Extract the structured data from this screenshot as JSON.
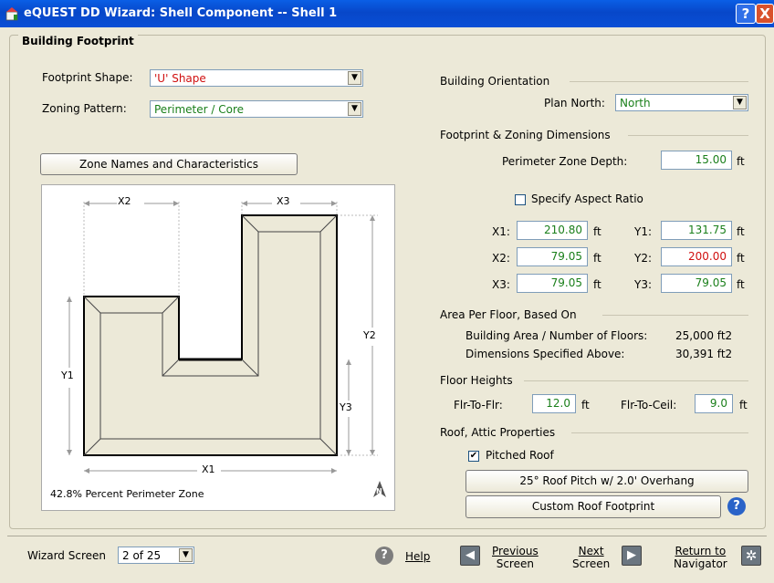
{
  "window": {
    "title": "eQUEST DD Wizard:  Shell Component  --  Shell 1",
    "help_glyph": "?",
    "close_glyph": "X"
  },
  "footprint": {
    "group_title": "Building Footprint",
    "shape_label": "Footprint Shape:",
    "shape_value": "'U' Shape",
    "zoning_label": "Zoning Pattern:",
    "zoning_value": "Perimeter / Core",
    "zone_button": "Zone Names and Characteristics"
  },
  "diagram": {
    "x1": "X1",
    "x2": "X2",
    "x3": "X3",
    "y1": "Y1",
    "y2": "Y2",
    "y3": "Y3",
    "percent_text": "42.8% Percent Perimeter Zone",
    "north": "N"
  },
  "orientation": {
    "title": "Building Orientation",
    "plan_north_label": "Plan North:",
    "plan_north_value": "North"
  },
  "dimensions": {
    "title": "Footprint & Zoning Dimensions",
    "perimeter_depth_label": "Perimeter Zone Depth:",
    "perimeter_depth_value": "15.00",
    "unit": "ft",
    "aspect_label": "Specify Aspect Ratio",
    "x1_label": "X1:",
    "x1_value": "210.80",
    "x2_label": "X2:",
    "x2_value": "79.05",
    "x3_label": "X3:",
    "x3_value": "79.05",
    "y1_label": "Y1:",
    "y1_value": "131.75",
    "y2_label": "Y2:",
    "y2_value": "200.00",
    "y3_label": "Y3:",
    "y3_value": "79.05"
  },
  "area": {
    "title": "Area Per Floor, Based On",
    "building_label": "Building Area / Number of Floors:",
    "building_value": "25,000 ft2",
    "dims_label": "Dimensions Specified Above:",
    "dims_value": "30,391 ft2"
  },
  "heights": {
    "title": "Floor Heights",
    "flr_label": "Flr-To-Flr:",
    "flr_value": "12.0",
    "ceil_label": "Flr-To-Ceil:",
    "ceil_value": "9.0",
    "unit": "ft"
  },
  "roof": {
    "title": "Roof, Attic Properties",
    "pitched_label": "Pitched Roof",
    "pitch_button": "25° Roof Pitch w/ 2.0' Overhang",
    "custom_button": "Custom Roof Footprint",
    "help_glyph": "?"
  },
  "bottom": {
    "wizard_label": "Wizard Screen",
    "wizard_value": "2 of 25",
    "help_label": "Help",
    "prev_line1": "Previous",
    "prev_line2": "Screen",
    "next_line1": "Next",
    "next_line2": "Screen",
    "return_line1": "Return to",
    "return_line2": "Navigator"
  }
}
